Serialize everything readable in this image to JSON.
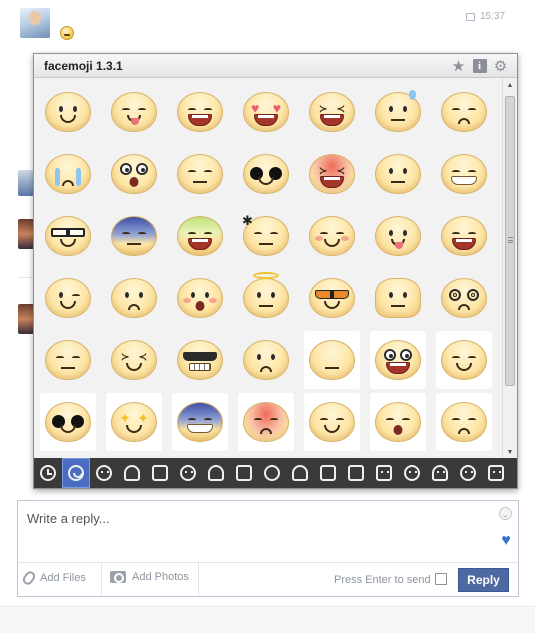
{
  "thread": {
    "timestamp": "15:37"
  },
  "popup": {
    "title": "facemoji 1.3.1",
    "icons": [
      "star-icon",
      "info-icon",
      "gear-icon"
    ],
    "info_glyph": "i"
  },
  "emojis": [
    "smile",
    "tongue-laugh",
    "big-grin",
    "heart-eyes",
    "squint-laugh",
    "sweat-drop",
    "worried",
    "crying",
    "shocked",
    "smirk",
    "star-shades",
    "xd-laugh",
    "content",
    "grimace-grin",
    "nerd-glasses",
    "blue-sick",
    "green-vomit",
    "angry",
    "blush",
    "tongue",
    "big-open",
    "wink",
    "frown",
    "pout",
    "angel",
    "cool-shades",
    "puffy",
    "dizzy",
    "expressionless",
    "laugh-tears",
    "teeth-shades",
    "skeptical",
    "neutral",
    "rolling-eyes",
    "meh-grin",
    "black-eyes",
    "sparkle-eyes",
    "blue-dread",
    "red-angry",
    "content-smile",
    "tired",
    "sad-frown"
  ],
  "categories": [
    {
      "name": "recent-category",
      "active": false
    },
    {
      "name": "smileys-category",
      "active": true
    },
    {
      "name": "faces2-category",
      "active": false
    },
    {
      "name": "animal-category",
      "active": false
    },
    {
      "name": "bird-category",
      "active": false
    },
    {
      "name": "glasses-category",
      "active": false
    },
    {
      "name": "ghost-category",
      "active": false
    },
    {
      "name": "cat-category",
      "active": false
    },
    {
      "name": "fruit-category",
      "active": false
    },
    {
      "name": "hat-category",
      "active": false
    },
    {
      "name": "cup-category",
      "active": false
    },
    {
      "name": "house-category",
      "active": false
    },
    {
      "name": "bus-category",
      "active": false
    },
    {
      "name": "hat2-category",
      "active": false
    },
    {
      "name": "skull-category",
      "active": false
    },
    {
      "name": "kitty-category",
      "active": false
    },
    {
      "name": "monster-category",
      "active": false
    }
  ],
  "composer": {
    "placeholder": "Write a reply...",
    "add_files": "Add Files",
    "add_photos": "Add Photos",
    "press_enter": "Press Enter to send",
    "reply_label": "Reply"
  }
}
